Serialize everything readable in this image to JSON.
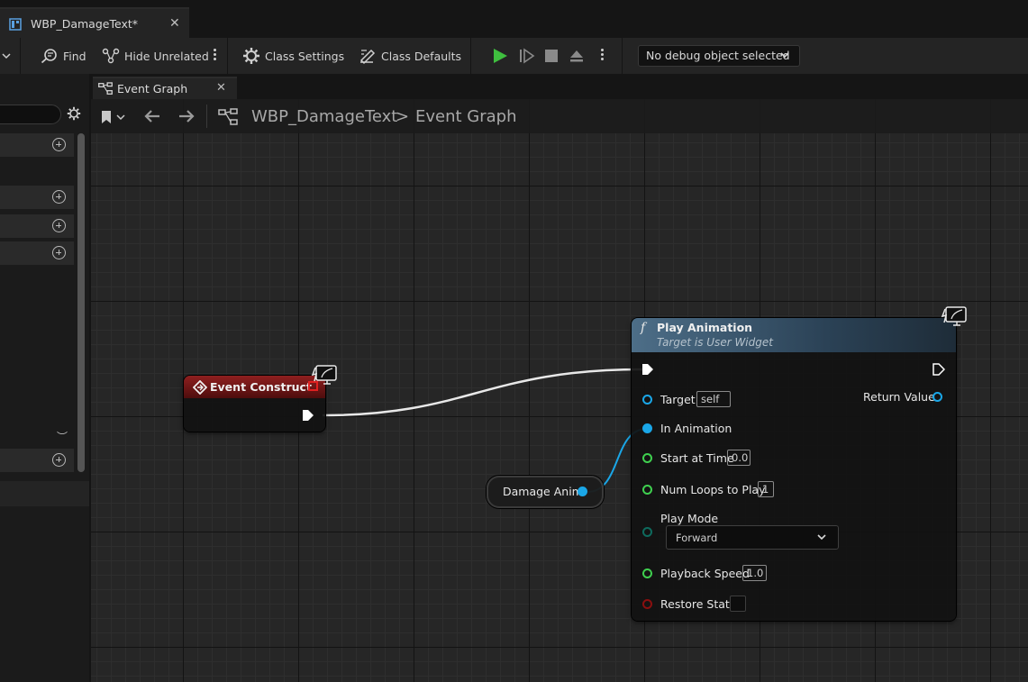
{
  "asset_tab": {
    "label": "WBP_DamageText*"
  },
  "toolbar": {
    "find": "Find",
    "hide_unrelated": "Hide Unrelated",
    "class_settings": "Class Settings",
    "class_defaults": "Class Defaults",
    "debug_select": "No debug object selected"
  },
  "graph_tab": {
    "label": "Event Graph"
  },
  "breadcrumb": {
    "root": "WBP_DamageText",
    "separator": ">",
    "current": "Event Graph"
  },
  "nodes": {
    "event_construct": {
      "title": "Event Construct"
    },
    "play_animation": {
      "title": "Play Animation",
      "subtitle": "Target is User Widget",
      "fn_glyph": "f",
      "pins": {
        "target": {
          "label": "Target",
          "value": "self"
        },
        "in_animation": {
          "label": "In Animation"
        },
        "start_at_time": {
          "label": "Start at Time",
          "value": "0.0"
        },
        "num_loops": {
          "label": "Num Loops to Play",
          "value": "1"
        },
        "play_mode": {
          "label": "Play Mode",
          "value": "Forward"
        },
        "playback_speed": {
          "label": "Playback Speed",
          "value": "1.0"
        },
        "restore_state": {
          "label": "Restore State"
        },
        "return_value": {
          "label": "Return Value"
        }
      }
    },
    "damage_anim": {
      "label": "Damage Anim"
    }
  },
  "colors": {
    "exec_wire": "#e8e8e8",
    "object_pin": "#1aa7e8",
    "float_pin": "#3fd04f",
    "event_header": "#8f1f1f",
    "function_header": "#4d6e88",
    "bool_pin": "#8a0f0f",
    "enum_pin": "#0e6a5d"
  }
}
